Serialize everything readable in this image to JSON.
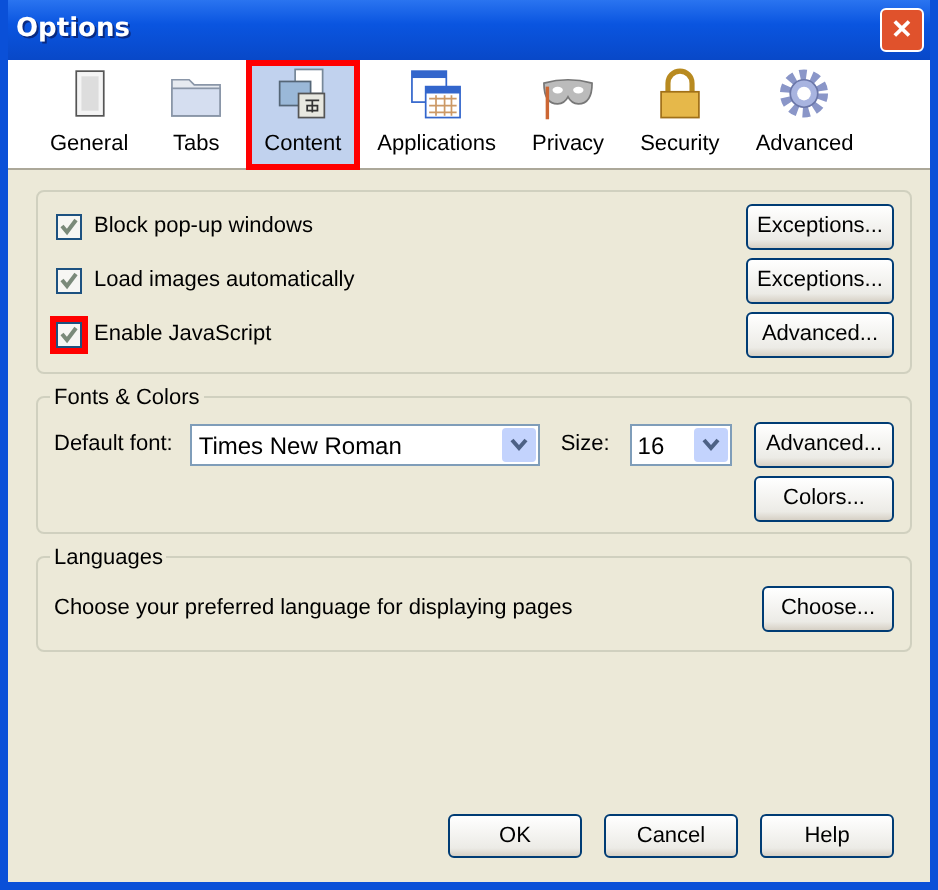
{
  "window": {
    "title": "Options",
    "close": "✕"
  },
  "tabs": [
    {
      "label": "General",
      "kind": "general",
      "selected": false,
      "highlighted": false
    },
    {
      "label": "Tabs",
      "kind": "tabs",
      "selected": false,
      "highlighted": false
    },
    {
      "label": "Content",
      "kind": "content",
      "selected": true,
      "highlighted": true
    },
    {
      "label": "Applications",
      "kind": "applications",
      "selected": false,
      "highlighted": false
    },
    {
      "label": "Privacy",
      "kind": "privacy",
      "selected": false,
      "highlighted": false
    },
    {
      "label": "Security",
      "kind": "security",
      "selected": false,
      "highlighted": false
    },
    {
      "label": "Advanced",
      "kind": "advanced",
      "selected": false,
      "highlighted": false
    }
  ],
  "options": [
    {
      "label": "Block pop-up windows",
      "checked": true,
      "highlighted": false,
      "button": "Exceptions..."
    },
    {
      "label": "Load images automatically",
      "checked": true,
      "highlighted": false,
      "button": "Exceptions..."
    },
    {
      "label": "Enable JavaScript",
      "checked": true,
      "highlighted": true,
      "button": "Advanced..."
    }
  ],
  "fonts": {
    "title": "Fonts & Colors",
    "font_label": "Default font:",
    "font_value": "Times New Roman",
    "size_label": "Size:",
    "size_value": "16",
    "buttons": [
      "Advanced...",
      "Colors..."
    ]
  },
  "languages": {
    "title": "Languages",
    "text": "Choose your preferred language for displaying pages",
    "button": "Choose..."
  },
  "buttons": [
    "OK",
    "Cancel",
    "Help"
  ]
}
